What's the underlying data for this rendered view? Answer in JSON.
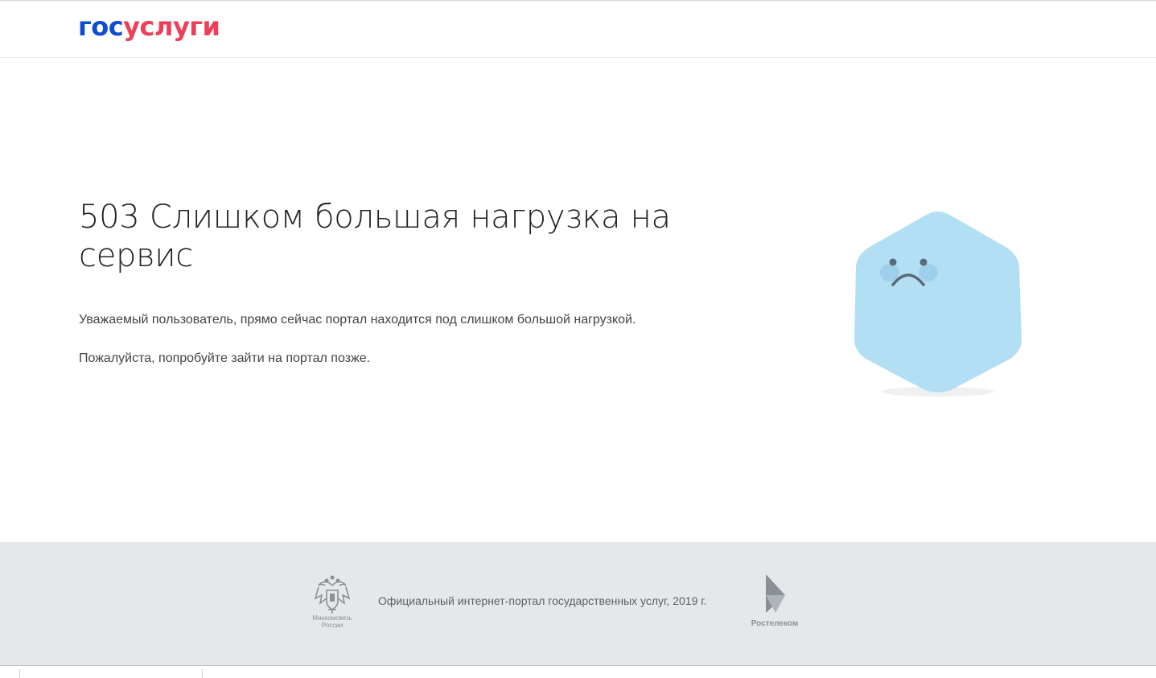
{
  "header": {
    "logo_part1": "гос",
    "logo_part2": "услуги"
  },
  "error": {
    "title": "503 Слишком большая нагрузка на сервис",
    "message_line1": "Уважаемый пользователь, прямо сейчас портал находится под слишком большой нагрузкой.",
    "message_line2": "Пожалуйста, попробуйте зайти на портал позже."
  },
  "illustration": {
    "icon": "sad-hexagon-icon",
    "fill_color": "#b3dff5"
  },
  "footer": {
    "ministry_logo_label_line1": "Минкомсвязь",
    "ministry_logo_label_line2": "России",
    "copyright": "Официальный интернет-портал государственных услуг, 2019 г.",
    "partner_logo_label": "Ростелеком"
  },
  "colors": {
    "brand_blue": "#0d4cd3",
    "brand_red": "#ee3f58",
    "footer_bg": "#e5e8eb"
  }
}
